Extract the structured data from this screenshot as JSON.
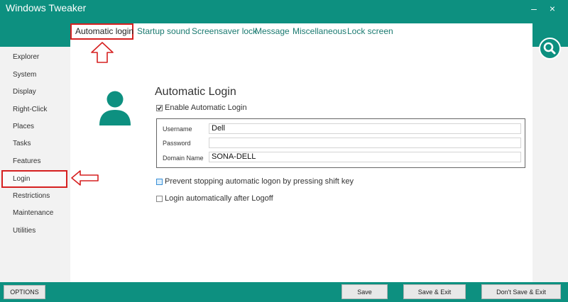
{
  "window": {
    "title": "Windows Tweaker",
    "minimize_symbol": "–",
    "close_symbol": "×"
  },
  "tabs": [
    {
      "label": "Automatic login"
    },
    {
      "label": "Startup sound"
    },
    {
      "label": "Screensaver lock"
    },
    {
      "label": "Message"
    },
    {
      "label": "Miscellaneous"
    },
    {
      "label": "Lock screen"
    }
  ],
  "sidebar": {
    "items": [
      {
        "label": "Explorer"
      },
      {
        "label": "System"
      },
      {
        "label": "Display"
      },
      {
        "label": "Right-Click"
      },
      {
        "label": "Places"
      },
      {
        "label": "Tasks"
      },
      {
        "label": "Features"
      },
      {
        "label": "Login"
      },
      {
        "label": "Restrictions"
      },
      {
        "label": "Maintenance"
      },
      {
        "label": "Utilities"
      }
    ],
    "selected": "Login"
  },
  "main": {
    "title": "Automatic Login",
    "enable_label": "Enable Automatic Login",
    "enable_checked": true,
    "username_label": "Username",
    "username_value": "Dell",
    "password_label": "Password",
    "password_value": "",
    "domain_label": "Domain Name",
    "domain_value": "SONA-DELL",
    "prevent_label": "Prevent stopping automatic logon by pressing shift key",
    "prevent_checked": false,
    "logoff_label": "Login automatically after Logoff",
    "logoff_checked": false
  },
  "footer": {
    "options_label": "OPTIONS",
    "save_label": "Save",
    "save_exit_label": "Save & Exit",
    "dont_save_label": "Don't Save & Exit"
  },
  "icons": {
    "search": "search-icon",
    "user": "user-icon",
    "arrow": "arrow-icon"
  },
  "colors": {
    "accent": "#0d9080",
    "highlight": "#d62020",
    "link": "#1a7a70"
  }
}
